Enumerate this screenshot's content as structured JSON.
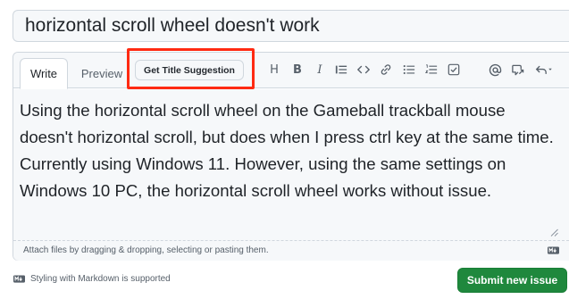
{
  "issue": {
    "title": "horizontal scroll wheel doesn't work",
    "body": "Using the horizontal scroll wheel on the Gameball trackball mouse doesn't horizontal scroll, but does when I press ctrl key at the same time. Currently using Windows 11. However, using the same settings on Windows 10 PC, the horizontal scroll wheel works without issue."
  },
  "tabs": {
    "write": "Write",
    "preview": "Preview"
  },
  "suggest_button": "Get Title Suggestion",
  "toolbar": {
    "heading": "H",
    "bold": "B",
    "italic": "I",
    "icons": [
      "heading-icon",
      "bold-icon",
      "italic-icon",
      "quote-icon",
      "code-icon",
      "link-icon",
      "bulleted-list-icon",
      "numbered-list-icon",
      "task-list-icon",
      "mention-icon",
      "reference-icon",
      "undo-icon"
    ]
  },
  "attach_hint": "Attach files by dragging & dropping, selecting or pasting them.",
  "markdown_note": "Styling with Markdown is supported",
  "submit_button": "Submit new issue",
  "colors": {
    "accent_green": "#1f883d",
    "highlight_red": "#ff2a12",
    "border": "#d0d7de",
    "muted_text": "#57606a"
  }
}
